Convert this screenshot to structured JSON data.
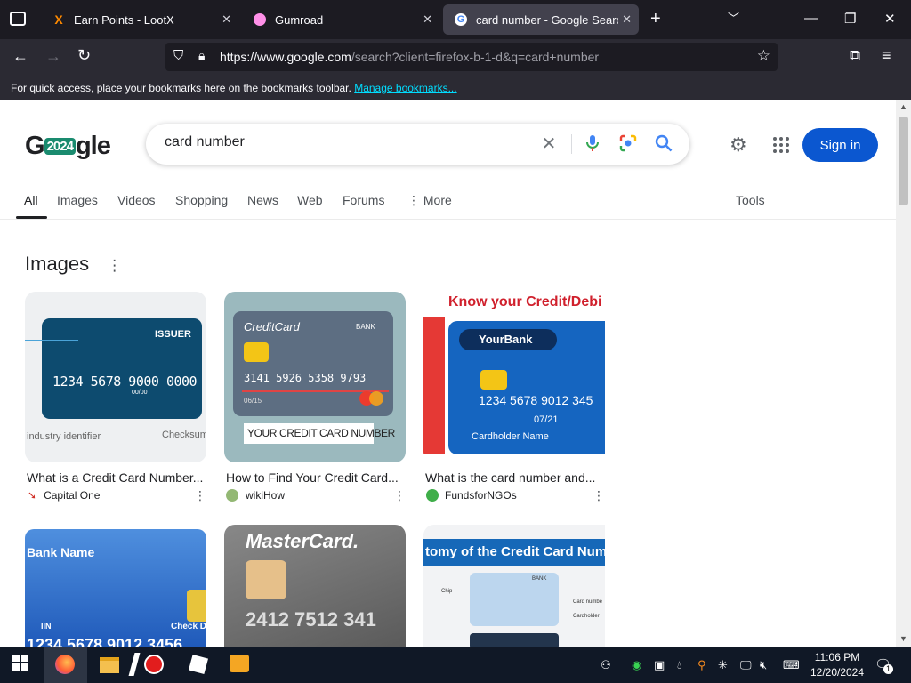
{
  "tabs": [
    {
      "title": "Earn Points - LootX",
      "icon": "lootx-icon"
    },
    {
      "title": "Gumroad",
      "icon": "gumroad-icon"
    },
    {
      "title": "card number - Google Search",
      "icon": "google-icon"
    }
  ],
  "toolbar": {
    "url_host": "https://www.google.com",
    "url_rest": "/search?client=firefox-b-1-d&q=card+number"
  },
  "bookmarks": {
    "text": "For quick access, place your bookmarks here on the bookmarks toolbar.",
    "link": "Manage bookmarks..."
  },
  "google": {
    "logo_left": "G",
    "logo_year": "2024",
    "logo_right": "gle",
    "query": "card number",
    "signin": "Sign in"
  },
  "nav_tabs": [
    "All",
    "Images",
    "Videos",
    "Shopping",
    "News",
    "Web",
    "Forums",
    "More",
    "Tools"
  ],
  "images_section": {
    "title": "Images",
    "results": [
      {
        "caption": "What is a Credit Card Number...",
        "source": "Capital One",
        "card_texts": [
          "ISSUER",
          "1234 5678 9000 0000",
          "00/00",
          "industry identifier",
          "Checksum"
        ]
      },
      {
        "caption": "How to Find Your Credit Card...",
        "source": "wikiHow",
        "card_texts": [
          "CreditCard",
          "BANK",
          "3141 5926 5358 9793",
          "06/15",
          "YOUR CREDIT CARD NUMBER"
        ]
      },
      {
        "caption": "What is the card number and...",
        "source": "FundsforNGOs",
        "card_texts": [
          "Know your Credit/Debi",
          "YourBank",
          "1234 5678 9012 345",
          "07/21",
          "Cardholder Name"
        ]
      },
      {
        "caption": "",
        "source": "",
        "card_texts": [
          "Bank Name",
          "IIN",
          "Check D",
          "1234 5678 9012 3456"
        ]
      },
      {
        "caption": "",
        "source": "",
        "card_texts": [
          "MasterCard.",
          "2412 7512 341"
        ]
      },
      {
        "caption": "",
        "source": "",
        "card_texts": [
          "tomy of the Credit Card Numb",
          "BANK",
          "Chip",
          "Card numbe",
          "Cardholder"
        ]
      }
    ]
  },
  "taskbar": {
    "time": "11:06 PM",
    "date": "12/20/2024",
    "notifications": "1"
  },
  "colors": {
    "accent": "#0b57d0",
    "tab_bg": "#1c1b22",
    "toolbar_bg": "#2b2a33"
  }
}
